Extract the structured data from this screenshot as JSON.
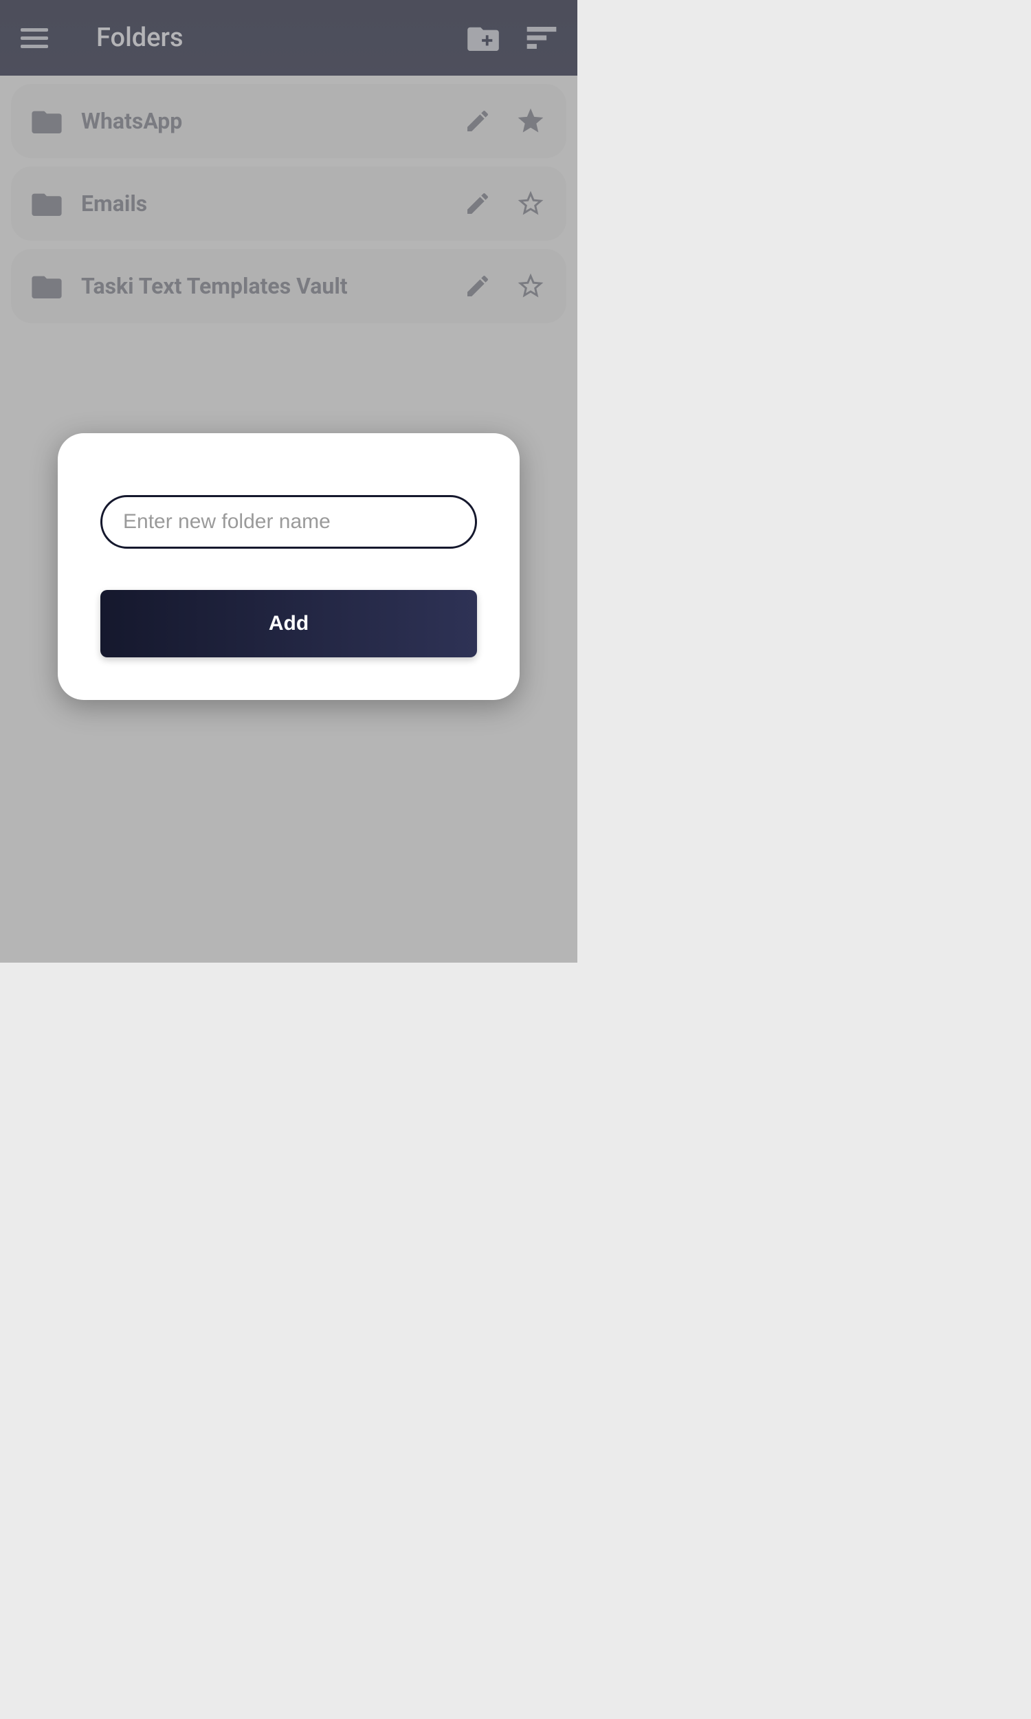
{
  "header": {
    "title": "Folders"
  },
  "folders": [
    {
      "name": "WhatsApp",
      "starred": true
    },
    {
      "name": "Emails",
      "starred": false
    },
    {
      "name": "Taski Text Templates Vault",
      "starred": false
    }
  ],
  "modal": {
    "placeholder": "Enter new folder name",
    "value": "",
    "button_label": "Add"
  }
}
